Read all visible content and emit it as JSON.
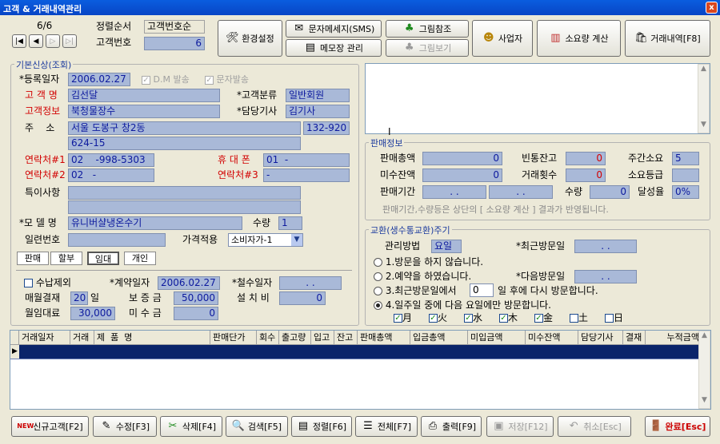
{
  "window": {
    "title": "고객 & 거래내역관리",
    "close": "x"
  },
  "nav": {
    "counter": "6/6",
    "sort_label": "정렬순서",
    "sort_value": "고객번호순",
    "custno_label": "고객번호",
    "custno_value": "6"
  },
  "toolbar": {
    "settings": "환경설정",
    "sms": "문자메세지(SMS)",
    "memo": "메모장 관리",
    "picture_ref": "그림참조",
    "picture_view": "그림보기",
    "business": "사업자",
    "usage_calc": "소요량 계산",
    "history": "거래내역[F8]"
  },
  "basic": {
    "title": "기본신상(조회)",
    "reg_date_label": "*등록일자",
    "reg_date": "2006.02.27",
    "dm_label": "D.M 발송",
    "sms_label": "문자발송",
    "name_label": "고 객 명",
    "name": "김선달",
    "class_label": "*고객분류",
    "class": "일반회원",
    "info_label": "고객정보",
    "info": "북청물장수",
    "driver_label": "*담당기사",
    "driver": "김기사",
    "addr_label": "주    소",
    "addr1": "서울 도봉구 창2동",
    "zip": "132-920",
    "addr2": "624-15",
    "tel1_label": "연락처#1",
    "tel1": "02    -998-5303",
    "mobile_label": "휴 대 폰",
    "mobile": "01  -",
    "tel2_label": "연락처#2",
    "tel2": "02   -",
    "tel3_label": "연락처#3",
    "tel3": "-",
    "notes_label": "특이사항",
    "model_label": "*모 델 명",
    "model": "유니버샬냉온수기",
    "qty_label": "수량",
    "qty": "1",
    "serial_label": "일련번호",
    "price_label": "가격적용",
    "price": "소비자가-1",
    "tabs": [
      "판매",
      "할부",
      "임대",
      "개인"
    ],
    "wash_label": "수납제외",
    "contract_label": "*계약일자",
    "contract": "2006.02.27",
    "withdraw_label": "*철수일자",
    "withdraw": ". .",
    "monthly_label": "매월결재",
    "monthly": "20",
    "monthly_unit": "일",
    "deposit_label": "보 증 금",
    "deposit": "50,000",
    "install_label": "설 치 비",
    "install": "0",
    "rent_label": "월임대료",
    "rent": "30,000",
    "unpaid_label": "미 수 금",
    "unpaid": "0"
  },
  "sales": {
    "title": "판매정보",
    "total_label": "판매총액",
    "total": "0",
    "empty_label": "빈통잔고",
    "empty": "0",
    "weekly_label": "주간소요",
    "weekly": "5",
    "balance_label": "미수잔액",
    "balance": "0",
    "count_label": "거래횟수",
    "count": "0",
    "grade_label": "소요등급",
    "grade": "",
    "period_label": "판매기간",
    "period1": ". .",
    "period2": ". .",
    "qty_label": "수량",
    "qty": "0",
    "rate_label": "달성율",
    "rate": "0%",
    "note": "판매기간,수량등은 상단의 [ 소요량 계산 ] 결과가 반영됩니다."
  },
  "exchange": {
    "title": "교환(생수통교환)주기",
    "method_label": "관리방법",
    "method": "요일",
    "last_label": "*최근방문일",
    "last": ". .",
    "opt1": "1.방문을 하지 않습니다.",
    "opt2": "2.예약을 하였습니다.",
    "next_label": "*다음방문일",
    "next": ". .",
    "opt3a": "3.최근방문일에서",
    "opt3_days": "0",
    "opt3b": "일 후에 다시 방문합니다.",
    "opt4": "4.일주일 중에 다음 요일에만 방문합니다.",
    "days": [
      "月",
      "火",
      "水",
      "木",
      "金",
      "土",
      "日"
    ]
  },
  "grid": {
    "columns": [
      "거래일자",
      "거래",
      "제  품  명",
      "판매단가",
      "회수",
      "출고량",
      "입고",
      "잔고",
      "판매총액",
      "입금총액",
      "미입금액",
      "미수잔액",
      "담당기사",
      "결재",
      "누적금액"
    ]
  },
  "bottom": {
    "new": "신규고객[F2]",
    "edit": "수정[F3]",
    "delete": "삭제[F4]",
    "search": "검색[F5]",
    "sort": "정렬[F6]",
    "all": "전체[F7]",
    "print": "출력[F9]",
    "save": "저장[F12]",
    "cancel": "취소[Esc]",
    "done": "완료[Esc]",
    "new_badge": "NEW"
  }
}
